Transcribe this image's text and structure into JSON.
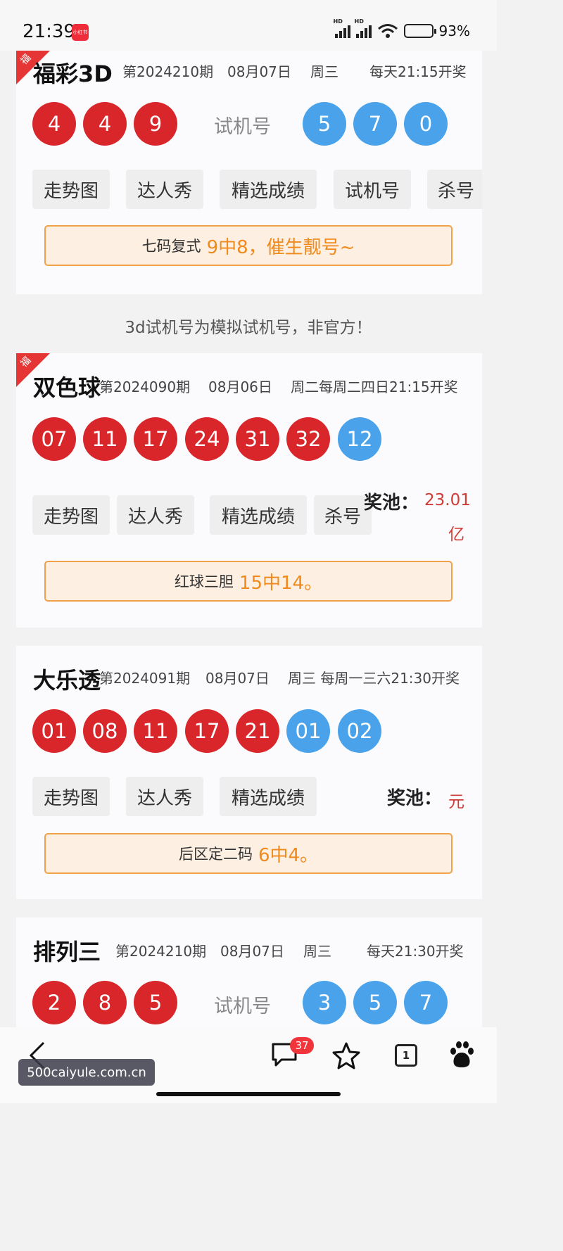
{
  "status_bar": {
    "time": "21:39",
    "app_badge": "小红书",
    "battery": "93%",
    "signal_label": "HD"
  },
  "fc3d": {
    "corner": "福",
    "name": "福彩3D",
    "issue": "第2024210期",
    "date": "08月07日",
    "weekday": "周三",
    "schedule": "每天21:15开奖",
    "balls": [
      "4",
      "4",
      "9"
    ],
    "trial_label": "试机号",
    "trial_balls": [
      "5",
      "7",
      "0"
    ],
    "chips": [
      "走势图",
      "达人秀",
      "精选成绩",
      "试机号",
      "杀号"
    ],
    "banner_label": "七码复式",
    "banner_highlight": "9中8，催生靓号~"
  },
  "notice": "3d试机号为模拟试机号，非官方！",
  "ssq": {
    "corner": "福",
    "name": "双色球",
    "issue": "第2024090期",
    "date": "08月06日",
    "schedule": "周二每周二四日21:15开奖",
    "red_balls": [
      "07",
      "11",
      "17",
      "24",
      "31",
      "32"
    ],
    "blue_balls": [
      "12"
    ],
    "chips": [
      "走势图",
      "达人秀",
      "精选成绩",
      "杀号"
    ],
    "pool_label": "奖池：",
    "pool_value_line1": "23.01",
    "pool_value_line2": "亿",
    "banner_label": "红球三胆",
    "banner_highlight": "15中14。"
  },
  "dlt": {
    "name": "大乐透",
    "issue": "第2024091期",
    "date": "08月07日",
    "schedule": "周三 每周一三六21:30开奖",
    "red_balls": [
      "01",
      "08",
      "11",
      "17",
      "21"
    ],
    "blue_balls": [
      "01",
      "02"
    ],
    "chips": [
      "走势图",
      "达人秀",
      "精选成绩"
    ],
    "pool_label": "奖池：",
    "pool_value": "元",
    "banner_label": "后区定二码",
    "banner_highlight": "6中4。"
  },
  "pl3": {
    "name": "排列三",
    "issue": "第2024210期",
    "date": "08月07日",
    "weekday": "周三",
    "schedule": "每天21:30开奖",
    "balls": [
      "2",
      "8",
      "5"
    ],
    "trial_label": "试机号",
    "trial_balls": [
      "3",
      "5",
      "7"
    ]
  },
  "bottom_bar": {
    "comment_count": "37",
    "tab_count": "1",
    "watermark": "500caiyule.com.cn"
  },
  "colors": {
    "red_ball": "#d8262a",
    "blue_ball": "#4aa3ea",
    "highlight": "#f08a1c",
    "pool": "#cf3b36"
  }
}
